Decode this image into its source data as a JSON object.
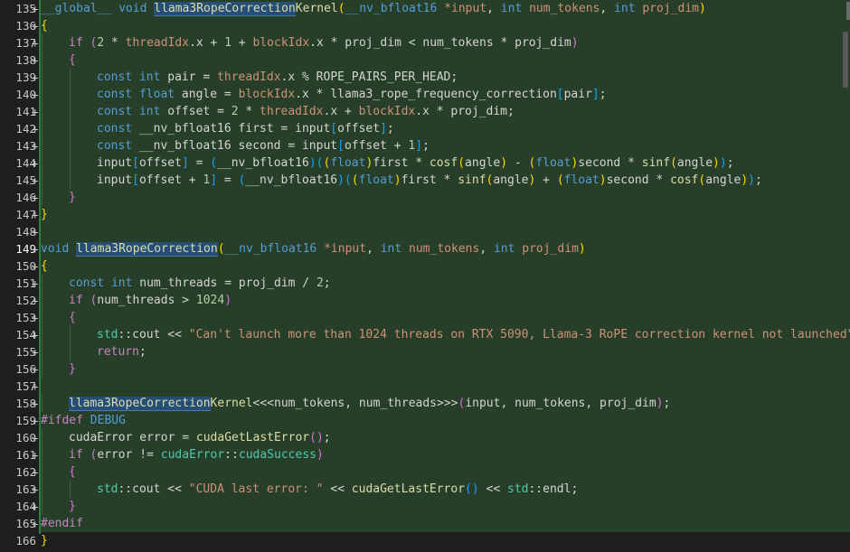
{
  "editor": {
    "lines": [
      {
        "n": "135+",
        "added": true,
        "segs": [
          {
            "c": "kw",
            "t": "__global__"
          },
          {
            "c": "var",
            "t": " "
          },
          {
            "c": "kw",
            "t": "void"
          },
          {
            "c": "var",
            "t": " "
          },
          {
            "c": "fn hl",
            "t": "llama3RopeCorrection"
          },
          {
            "c": "fn",
            "t": "Kernel"
          },
          {
            "c": "br1",
            "t": "("
          },
          {
            "c": "kw",
            "t": "__nv_bfloat16"
          },
          {
            "c": "var",
            "t": " "
          },
          {
            "c": "org",
            "t": "*input"
          },
          {
            "c": "var",
            "t": ", "
          },
          {
            "c": "kw",
            "t": "int"
          },
          {
            "c": "var",
            "t": " "
          },
          {
            "c": "org",
            "t": "num_tokens"
          },
          {
            "c": "var",
            "t": ", "
          },
          {
            "c": "kw",
            "t": "int"
          },
          {
            "c": "var",
            "t": " "
          },
          {
            "c": "org",
            "t": "proj_dim"
          },
          {
            "c": "br1",
            "t": ")"
          }
        ]
      },
      {
        "n": "136+",
        "added": true,
        "segs": [
          {
            "c": "br1",
            "t": "{"
          }
        ]
      },
      {
        "n": "137+",
        "added": true,
        "indent": 1,
        "segs": [
          {
            "c": "ctl",
            "t": "if"
          },
          {
            "c": "var",
            "t": " "
          },
          {
            "c": "br2",
            "t": "("
          },
          {
            "c": "num",
            "t": "2"
          },
          {
            "c": "var",
            "t": " * "
          },
          {
            "c": "org",
            "t": "threadIdx"
          },
          {
            "c": "var",
            "t": ".x + "
          },
          {
            "c": "num",
            "t": "1"
          },
          {
            "c": "var",
            "t": " + "
          },
          {
            "c": "org",
            "t": "blockIdx"
          },
          {
            "c": "var",
            "t": ".x * proj_dim < num_tokens * proj_dim"
          },
          {
            "c": "br2",
            "t": ")"
          }
        ]
      },
      {
        "n": "138+",
        "added": true,
        "indent": 1,
        "segs": [
          {
            "c": "br2",
            "t": "{"
          }
        ]
      },
      {
        "n": "139+",
        "added": true,
        "indent": 2,
        "segs": [
          {
            "c": "kw",
            "t": "const"
          },
          {
            "c": "var",
            "t": " "
          },
          {
            "c": "kw",
            "t": "int"
          },
          {
            "c": "var",
            "t": " pair = "
          },
          {
            "c": "org",
            "t": "threadIdx"
          },
          {
            "c": "var",
            "t": ".x % ROPE_PAIRS_PER_HEAD;"
          }
        ]
      },
      {
        "n": "140+",
        "added": true,
        "indent": 2,
        "segs": [
          {
            "c": "kw",
            "t": "const"
          },
          {
            "c": "var",
            "t": " "
          },
          {
            "c": "kw",
            "t": "float"
          },
          {
            "c": "var",
            "t": " angle = "
          },
          {
            "c": "org",
            "t": "blockIdx"
          },
          {
            "c": "var",
            "t": ".x * llama3_rope_frequency_correction"
          },
          {
            "c": "br3",
            "t": "["
          },
          {
            "c": "var",
            "t": "pair"
          },
          {
            "c": "br3",
            "t": "]"
          },
          {
            "c": "var",
            "t": ";"
          }
        ]
      },
      {
        "n": "141+",
        "added": true,
        "indent": 2,
        "segs": [
          {
            "c": "kw",
            "t": "const"
          },
          {
            "c": "var",
            "t": " "
          },
          {
            "c": "kw",
            "t": "int"
          },
          {
            "c": "var",
            "t": " offset = "
          },
          {
            "c": "num",
            "t": "2"
          },
          {
            "c": "var",
            "t": " * "
          },
          {
            "c": "org",
            "t": "threadIdx"
          },
          {
            "c": "var",
            "t": ".x + "
          },
          {
            "c": "org",
            "t": "blockIdx"
          },
          {
            "c": "var",
            "t": ".x * proj_dim;"
          }
        ]
      },
      {
        "n": "142+",
        "added": true,
        "indent": 2,
        "segs": [
          {
            "c": "kw",
            "t": "const"
          },
          {
            "c": "var",
            "t": " __nv_bfloat16 first = input"
          },
          {
            "c": "br3",
            "t": "["
          },
          {
            "c": "var",
            "t": "offset"
          },
          {
            "c": "br3",
            "t": "]"
          },
          {
            "c": "var",
            "t": ";"
          }
        ]
      },
      {
        "n": "143+",
        "added": true,
        "indent": 2,
        "segs": [
          {
            "c": "kw",
            "t": "const"
          },
          {
            "c": "var",
            "t": " __nv_bfloat16 second = input"
          },
          {
            "c": "br3",
            "t": "["
          },
          {
            "c": "var",
            "t": "offset + "
          },
          {
            "c": "num",
            "t": "1"
          },
          {
            "c": "br3",
            "t": "]"
          },
          {
            "c": "var",
            "t": ";"
          }
        ]
      },
      {
        "n": "144+",
        "added": true,
        "indent": 2,
        "segs": [
          {
            "c": "var",
            "t": "input"
          },
          {
            "c": "br3",
            "t": "["
          },
          {
            "c": "var",
            "t": "offset"
          },
          {
            "c": "br3",
            "t": "]"
          },
          {
            "c": "var",
            "t": " = "
          },
          {
            "c": "br3",
            "t": "("
          },
          {
            "c": "var",
            "t": "__nv_bfloat16"
          },
          {
            "c": "br3",
            "t": ")"
          },
          {
            "c": "br3",
            "t": "("
          },
          {
            "c": "br1",
            "t": "("
          },
          {
            "c": "kw",
            "t": "float"
          },
          {
            "c": "br1",
            "t": ")"
          },
          {
            "c": "var",
            "t": "first * "
          },
          {
            "c": "fn",
            "t": "cosf"
          },
          {
            "c": "br1",
            "t": "("
          },
          {
            "c": "var",
            "t": "angle"
          },
          {
            "c": "br1",
            "t": ")"
          },
          {
            "c": "var",
            "t": " - "
          },
          {
            "c": "br1",
            "t": "("
          },
          {
            "c": "kw",
            "t": "float"
          },
          {
            "c": "br1",
            "t": ")"
          },
          {
            "c": "var",
            "t": "second * "
          },
          {
            "c": "fn",
            "t": "sinf"
          },
          {
            "c": "br1",
            "t": "("
          },
          {
            "c": "var",
            "t": "angle"
          },
          {
            "c": "br1",
            "t": ")"
          },
          {
            "c": "br3",
            "t": ")"
          },
          {
            "c": "var",
            "t": ";"
          }
        ]
      },
      {
        "n": "145+",
        "added": true,
        "indent": 2,
        "segs": [
          {
            "c": "var",
            "t": "input"
          },
          {
            "c": "br3",
            "t": "["
          },
          {
            "c": "var",
            "t": "offset + "
          },
          {
            "c": "num",
            "t": "1"
          },
          {
            "c": "br3",
            "t": "]"
          },
          {
            "c": "var",
            "t": " = "
          },
          {
            "c": "br3",
            "t": "("
          },
          {
            "c": "var",
            "t": "__nv_bfloat16"
          },
          {
            "c": "br3",
            "t": ")"
          },
          {
            "c": "br3",
            "t": "("
          },
          {
            "c": "br1",
            "t": "("
          },
          {
            "c": "kw",
            "t": "float"
          },
          {
            "c": "br1",
            "t": ")"
          },
          {
            "c": "var",
            "t": "first * "
          },
          {
            "c": "fn",
            "t": "sinf"
          },
          {
            "c": "br1",
            "t": "("
          },
          {
            "c": "var",
            "t": "angle"
          },
          {
            "c": "br1",
            "t": ")"
          },
          {
            "c": "var",
            "t": " + "
          },
          {
            "c": "br1",
            "t": "("
          },
          {
            "c": "kw",
            "t": "float"
          },
          {
            "c": "br1",
            "t": ")"
          },
          {
            "c": "var",
            "t": "second * "
          },
          {
            "c": "fn",
            "t": "cosf"
          },
          {
            "c": "br1",
            "t": "("
          },
          {
            "c": "var",
            "t": "angle"
          },
          {
            "c": "br1",
            "t": ")"
          },
          {
            "c": "br3",
            "t": ")"
          },
          {
            "c": "var",
            "t": ";"
          }
        ]
      },
      {
        "n": "146+",
        "added": true,
        "indent": 1,
        "segs": [
          {
            "c": "br2",
            "t": "}"
          }
        ]
      },
      {
        "n": "147+",
        "added": true,
        "segs": [
          {
            "c": "br1",
            "t": "}"
          }
        ]
      },
      {
        "n": "148+",
        "added": true,
        "segs": []
      },
      {
        "n": "149+",
        "added": true,
        "bold": true,
        "segs": [
          {
            "c": "kw",
            "t": "void"
          },
          {
            "c": "var",
            "t": " "
          },
          {
            "c": "fn hl",
            "t": "llama3RopeCorrection"
          },
          {
            "c": "br1",
            "t": "("
          },
          {
            "c": "kw",
            "t": "__nv_bfloat16"
          },
          {
            "c": "var",
            "t": " "
          },
          {
            "c": "org",
            "t": "*input"
          },
          {
            "c": "var",
            "t": ", "
          },
          {
            "c": "kw",
            "t": "int"
          },
          {
            "c": "var",
            "t": " "
          },
          {
            "c": "org",
            "t": "num_tokens"
          },
          {
            "c": "var",
            "t": ", "
          },
          {
            "c": "kw",
            "t": "int"
          },
          {
            "c": "var",
            "t": " "
          },
          {
            "c": "org",
            "t": "proj_dim"
          },
          {
            "c": "br1",
            "t": ")"
          }
        ]
      },
      {
        "n": "150+",
        "added": true,
        "segs": [
          {
            "c": "br1",
            "t": "{"
          }
        ]
      },
      {
        "n": "151+",
        "added": true,
        "indent": 1,
        "segs": [
          {
            "c": "kw",
            "t": "const"
          },
          {
            "c": "var",
            "t": " "
          },
          {
            "c": "kw",
            "t": "int"
          },
          {
            "c": "var",
            "t": " num_threads = proj_dim / "
          },
          {
            "c": "num",
            "t": "2"
          },
          {
            "c": "var",
            "t": ";"
          }
        ]
      },
      {
        "n": "152+",
        "added": true,
        "indent": 1,
        "segs": [
          {
            "c": "ctl",
            "t": "if"
          },
          {
            "c": "var",
            "t": " "
          },
          {
            "c": "br2",
            "t": "("
          },
          {
            "c": "var",
            "t": "num_threads > "
          },
          {
            "c": "num",
            "t": "1024"
          },
          {
            "c": "br2",
            "t": ")"
          }
        ]
      },
      {
        "n": "153+",
        "added": true,
        "indent": 1,
        "segs": [
          {
            "c": "br2",
            "t": "{"
          }
        ]
      },
      {
        "n": "154+",
        "added": true,
        "indent": 2,
        "segs": [
          {
            "c": "kw2",
            "t": "std"
          },
          {
            "c": "var",
            "t": "::cout << "
          },
          {
            "c": "str",
            "t": "\"Can't launch more than 1024 threads on RTX 5090, Llama-3 RoPE correction kernel not launched\""
          },
          {
            "c": "var",
            "t": ";"
          }
        ]
      },
      {
        "n": "155+",
        "added": true,
        "indent": 2,
        "segs": [
          {
            "c": "ctl",
            "t": "return"
          },
          {
            "c": "var",
            "t": ";"
          }
        ]
      },
      {
        "n": "156+",
        "added": true,
        "indent": 1,
        "segs": [
          {
            "c": "br2",
            "t": "}"
          }
        ]
      },
      {
        "n": "157+",
        "added": true,
        "segs": []
      },
      {
        "n": "158+",
        "added": true,
        "indent": 1,
        "segs": [
          {
            "c": "fn hl",
            "t": "llama3RopeCorrection"
          },
          {
            "c": "fn",
            "t": "Kernel"
          },
          {
            "c": "var",
            "t": "<<<num_tokens, num_threads>>>"
          },
          {
            "c": "br2",
            "t": "("
          },
          {
            "c": "var",
            "t": "input, num_tokens, proj_dim"
          },
          {
            "c": "br2",
            "t": ")"
          },
          {
            "c": "var",
            "t": ";"
          }
        ]
      },
      {
        "n": "159+",
        "added": true,
        "segs": [
          {
            "c": "pp",
            "t": "#ifdef"
          },
          {
            "c": "var",
            "t": " "
          },
          {
            "c": "kw",
            "t": "DEBUG"
          }
        ]
      },
      {
        "n": "160+",
        "added": true,
        "indent": 1,
        "segs": [
          {
            "c": "var",
            "t": "cudaError error = "
          },
          {
            "c": "fn",
            "t": "cudaGetLastError"
          },
          {
            "c": "br2",
            "t": "()"
          },
          {
            "c": "var",
            "t": ";"
          }
        ]
      },
      {
        "n": "161+",
        "added": true,
        "indent": 1,
        "segs": [
          {
            "c": "ctl",
            "t": "if"
          },
          {
            "c": "var",
            "t": " "
          },
          {
            "c": "br2",
            "t": "("
          },
          {
            "c": "var",
            "t": "error != "
          },
          {
            "c": "kw2",
            "t": "cudaError"
          },
          {
            "c": "var",
            "t": "::"
          },
          {
            "c": "kw2",
            "t": "cudaSuccess"
          },
          {
            "c": "br2",
            "t": ")"
          }
        ]
      },
      {
        "n": "162+",
        "added": true,
        "indent": 1,
        "segs": [
          {
            "c": "br2",
            "t": "{"
          }
        ]
      },
      {
        "n": "163+",
        "added": true,
        "indent": 2,
        "segs": [
          {
            "c": "kw2",
            "t": "std"
          },
          {
            "c": "var",
            "t": "::cout << "
          },
          {
            "c": "str",
            "t": "\"CUDA last error: \""
          },
          {
            "c": "var",
            "t": " << "
          },
          {
            "c": "fn",
            "t": "cudaGetLastError"
          },
          {
            "c": "br3",
            "t": "()"
          },
          {
            "c": "var",
            "t": " << "
          },
          {
            "c": "kw2",
            "t": "std"
          },
          {
            "c": "var",
            "t": "::endl;"
          }
        ]
      },
      {
        "n": "164+",
        "added": true,
        "indent": 1,
        "segs": [
          {
            "c": "br2",
            "t": "}"
          }
        ]
      },
      {
        "n": "165+",
        "added": true,
        "segs": [
          {
            "c": "pp",
            "t": "#endif"
          }
        ]
      },
      {
        "n": "166",
        "added": false,
        "segs": [
          {
            "c": "br1",
            "t": "}"
          }
        ]
      }
    ]
  }
}
